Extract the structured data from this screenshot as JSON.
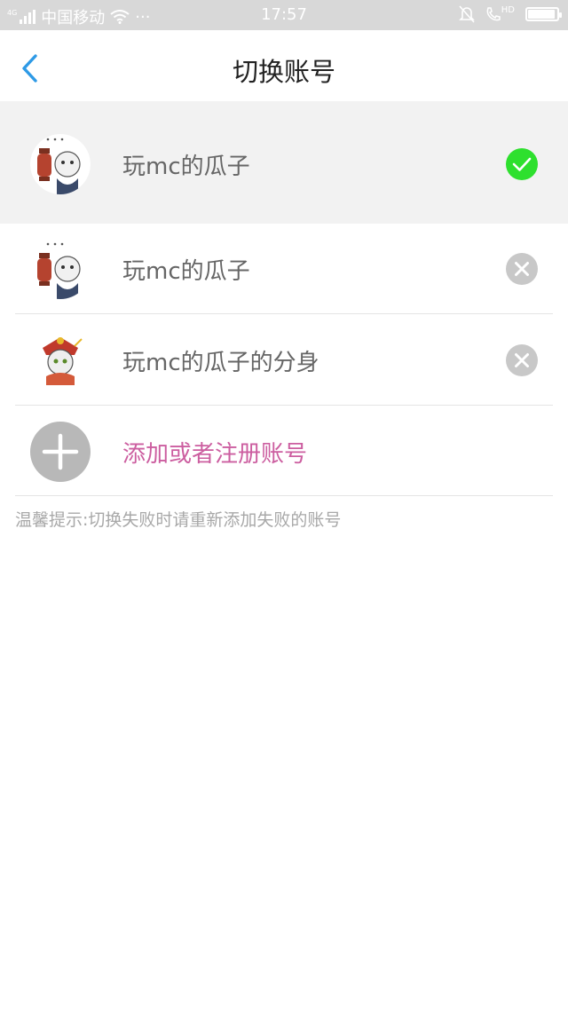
{
  "status_bar": {
    "network_label": "4G",
    "carrier": "中国移动",
    "dots": "···",
    "time": "17:57",
    "call_label": "HD"
  },
  "header": {
    "title": "切换账号",
    "back_icon": "chevron-left-icon"
  },
  "current_account": {
    "name": "玩mc的瓜子",
    "status_icon": "check-circle-icon",
    "status_color": "#2ee02e"
  },
  "accounts": [
    {
      "name": "玩mc的瓜子",
      "action_icon": "remove-circle-icon"
    },
    {
      "name": "玩mc的瓜子的分身",
      "action_icon": "remove-circle-icon"
    }
  ],
  "add_account": {
    "label": "添加或者注册账号",
    "icon": "plus-icon",
    "label_color": "#cc5ea0"
  },
  "tip": "温馨提示:切换失败时请重新添加失败的账号",
  "colors": {
    "accent": "#2e9ae6",
    "status_bar_bg": "#d8d8d8",
    "section_bg": "#f2f2f2"
  }
}
